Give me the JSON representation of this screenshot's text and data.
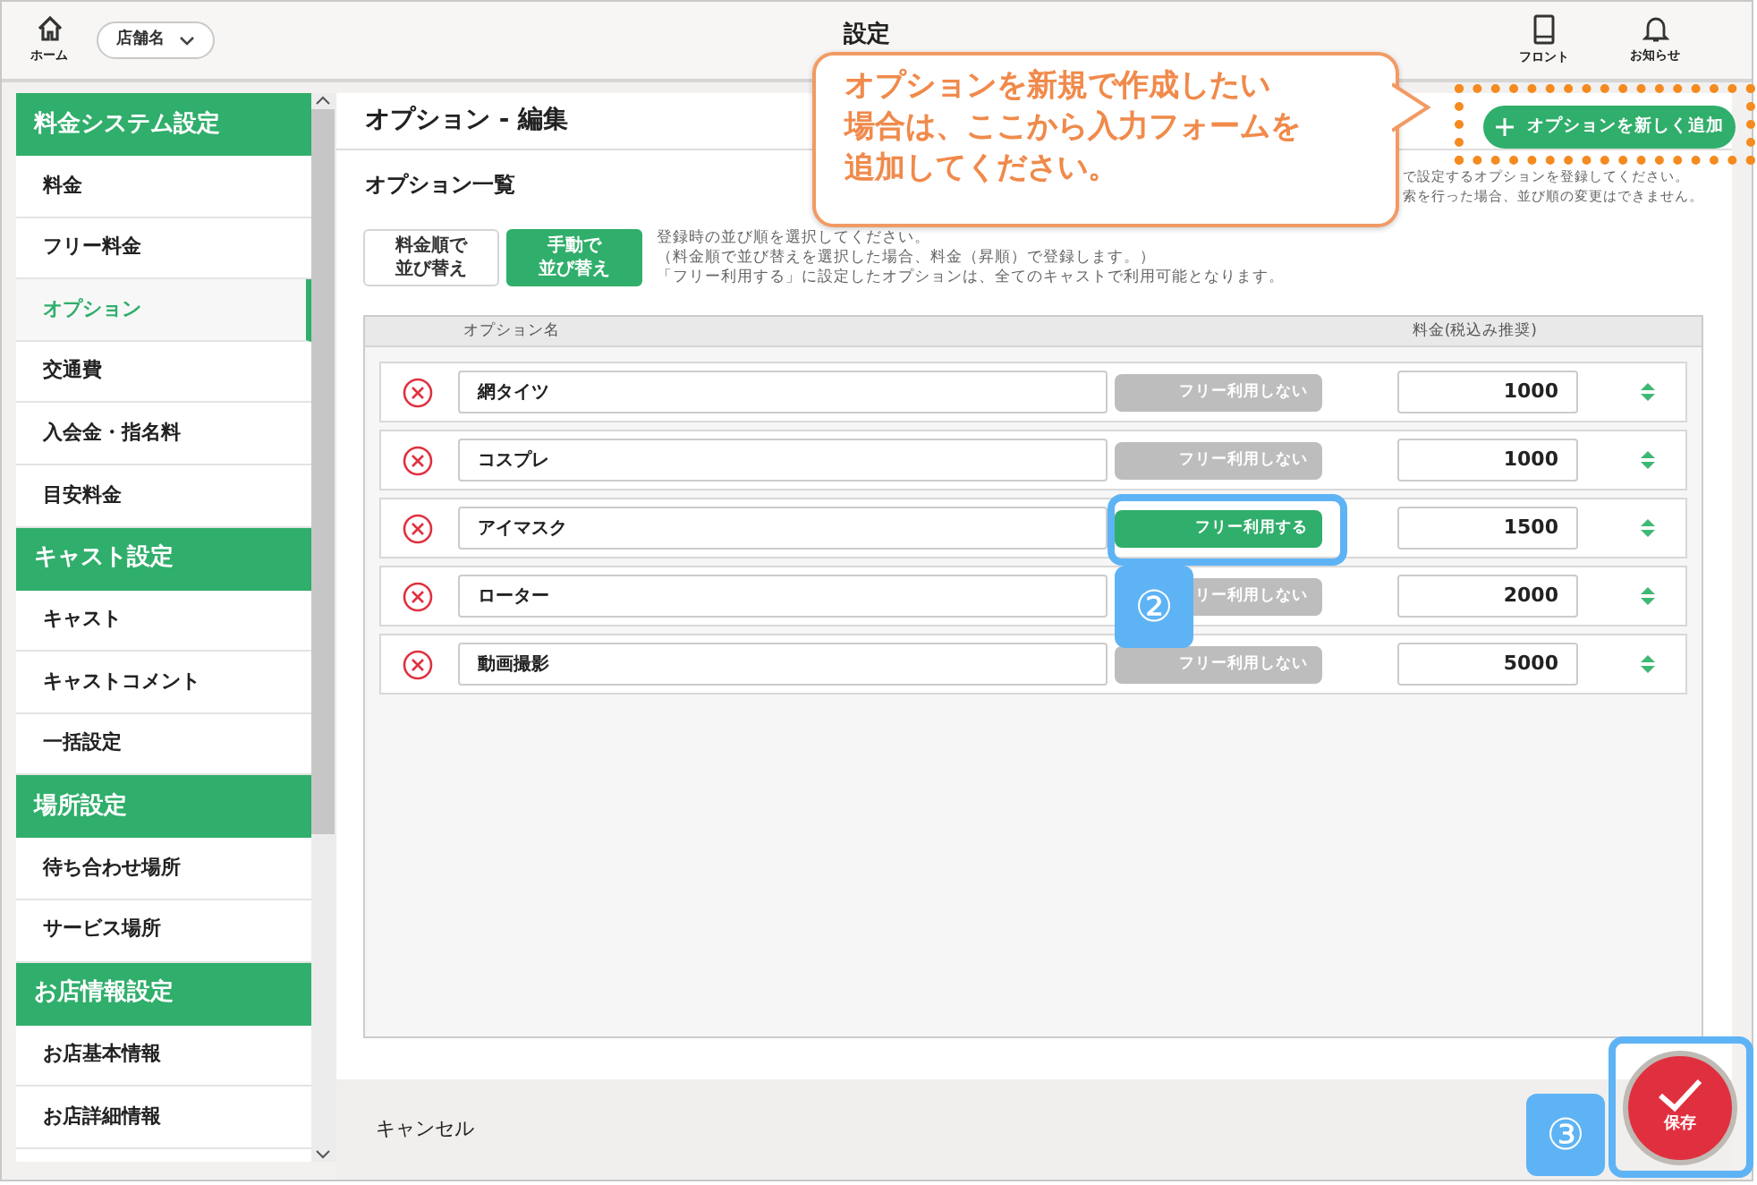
{
  "header": {
    "home_label": "ホーム",
    "store_select": "店舗名",
    "title": "設定",
    "front_label": "フロント",
    "notice_label": "お知らせ"
  },
  "sidebar": {
    "sections": [
      {
        "title": "料金システム設定",
        "items": [
          {
            "label": "料金",
            "selected": false
          },
          {
            "label": "フリー料金",
            "selected": false
          },
          {
            "label": "オプション",
            "selected": true
          },
          {
            "label": "交通費",
            "selected": false
          },
          {
            "label": "入会金・指名料",
            "selected": false
          },
          {
            "label": "目安料金",
            "selected": false
          }
        ]
      },
      {
        "title": "キャスト設定",
        "items": [
          {
            "label": "キャスト",
            "selected": false
          },
          {
            "label": "キャストコメント",
            "selected": false
          },
          {
            "label": "一括設定",
            "selected": false
          }
        ]
      },
      {
        "title": "場所設定",
        "items": [
          {
            "label": "待ち合わせ場所",
            "selected": false
          },
          {
            "label": "サービス場所",
            "selected": false
          }
        ]
      },
      {
        "title": "お店情報設定",
        "items": [
          {
            "label": "お店基本情報",
            "selected": false
          },
          {
            "label": "お店詳細情報",
            "selected": false
          }
        ]
      }
    ]
  },
  "editor": {
    "title": "オプション - 編集",
    "list_title": "オプション一覧",
    "description_lines": [
      "で設定するオプションを登録してください。",
      "索を行った場合、並び順の変更はできません。"
    ],
    "add_button": "オプションを新しく追加",
    "sort_buttons": [
      {
        "label_lines": [
          "料金順で",
          "並び替え"
        ],
        "selected": false
      },
      {
        "label_lines": [
          "手動で",
          "並び替え"
        ],
        "selected": true
      }
    ],
    "sort_help": [
      "登録時の並び順を選択してください。",
      "（料金順で並び替えを選択した場合、料金（昇順）で登録します。）",
      "「フリー利用する」に設定したオプションは、全てのキャストで利用可能となります。"
    ],
    "columns": [
      "オプション名",
      "料金(税込み推奨)"
    ],
    "rows": [
      {
        "name": "網タイツ",
        "free_label": "フリー利用しない",
        "free": false,
        "price": "1000"
      },
      {
        "name": "コスプレ",
        "free_label": "フリー利用しない",
        "free": false,
        "price": "1000"
      },
      {
        "name": "アイマスク",
        "free_label": "フリー利用する",
        "free": true,
        "price": "1500"
      },
      {
        "name": "ローター",
        "free_label": "リー利用しない",
        "free": false,
        "price": "2000"
      },
      {
        "name": "動画撮影",
        "free_label": "フリー利用しない",
        "free": false,
        "price": "5000"
      }
    ]
  },
  "footer": {
    "cancel": "キャンセル",
    "save": "保存"
  },
  "annotations": {
    "callout_lines": [
      "オプションを新規で作成したい",
      "場合は、ここから入力フォームを",
      "追加してください。"
    ],
    "markers": [
      "②",
      "③"
    ]
  }
}
